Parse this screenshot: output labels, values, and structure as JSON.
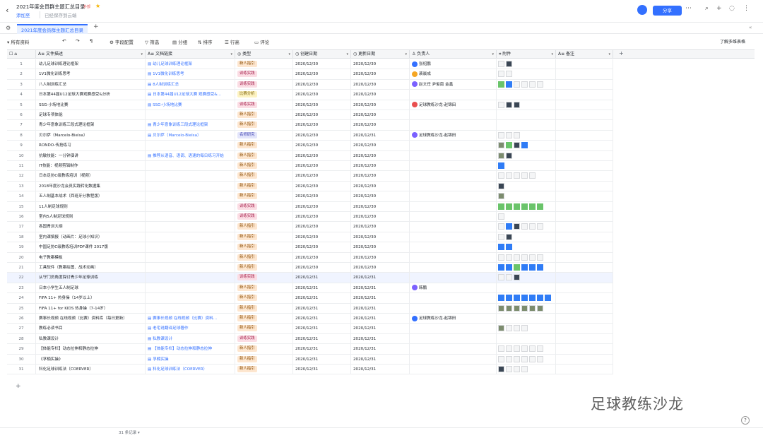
{
  "header": {
    "title": "2021年度会员群主题汇总目录",
    "badge": "外部",
    "add_to": "添加至",
    "saved": "已经保存到云端",
    "share": "分享"
  },
  "tab": {
    "name": "2021年度会员群主题汇总目录"
  },
  "toolbar": {
    "all_data": "所有资料",
    "field_config": "字段配置",
    "filter": "筛选",
    "group": "分组",
    "sort": "排序",
    "row_height": "行高",
    "comment": "评论",
    "learn": "了解多维表格"
  },
  "columns": {
    "name": "文件描述",
    "link": "文档链接",
    "type": "类型",
    "created": "创建日期",
    "updated": "更新日期",
    "owner": "负责人",
    "attachment": "附件",
    "note": "备注"
  },
  "rows": [
    {
      "no": "1",
      "name": "幼儿足球训练理论框架",
      "link": "幼儿足球训练理论框架",
      "type": "新人指引",
      "tc": "new",
      "created": "2020/12/30",
      "updated": "2020/12/30",
      "owner": "张绍鹏",
      "att": "pd"
    },
    {
      "no": "2",
      "name": "1V1微化训练思考",
      "link": "1V1微化训练思考",
      "type": "训练实践",
      "tc": "train",
      "created": "2020/12/30",
      "updated": "2020/12/30",
      "owner": "裴晨成",
      "att": "pp"
    },
    {
      "no": "3",
      "name": "八人制训练汇总",
      "link": "8人制训练汇总",
      "type": "训练实践",
      "tc": "train",
      "created": "2020/12/30",
      "updated": "2020/12/30",
      "owner": "赵文任  尹俊南  金鑫",
      "att": "gbpppp"
    },
    {
      "no": "4",
      "name": "日本第44届U12足球大赛观赛感受&分析",
      "link": "日本第44届U12足球大赛 观赛感受&...",
      "type": "比赛分析",
      "tc": "biz",
      "created": "2020/12/30",
      "updated": "2020/12/30",
      "owner": "",
      "att": ""
    },
    {
      "no": "5",
      "name": "SSG-小场地比赛",
      "link": "SSG-小场地比赛",
      "type": "训练实践",
      "tc": "train",
      "created": "2020/12/30",
      "updated": "2020/12/30",
      "owner": "足球教练沙龙-赵锦田",
      "att": "pdd"
    },
    {
      "no": "6",
      "name": "足球专项体能",
      "link": "",
      "type": "新人指引",
      "tc": "new",
      "created": "2020/12/30",
      "updated": "2020/12/30",
      "owner": "",
      "att": ""
    },
    {
      "no": "7",
      "name": "青少年意象训练三段式理论框架",
      "link": "青少年意象训练三段式理论框架",
      "type": "新人指引",
      "tc": "new",
      "created": "2020/12/30",
      "updated": "2020/12/30",
      "owner": "",
      "att": ""
    },
    {
      "no": "8",
      "name": "贝尔萨（Marcelo-Bielsa）",
      "link": "贝尔萨（Marcelo-Bielsa）",
      "type": "名师研究",
      "tc": "pro",
      "created": "2020/12/30",
      "updated": "2020/12/31",
      "owner": "足球教练沙龙-赵锦田",
      "att": "ppp"
    },
    {
      "no": "9",
      "name": "RONDO-传抢练习",
      "link": "",
      "type": "新人指引",
      "tc": "new",
      "created": "2020/12/30",
      "updated": "2020/12/30",
      "owner": "",
      "att": "ngdb"
    },
    {
      "no": "10",
      "name": "抗敏技能：一分钟演讲",
      "link": "推荐从语音、语调、语速的每日练习开始",
      "type": "新人指引",
      "tc": "new",
      "created": "2020/12/30",
      "updated": "2020/12/30",
      "owner": "",
      "att": "nd"
    },
    {
      "no": "11",
      "name": "IT技能：视频剪辑制作",
      "link": "",
      "type": "新人指引",
      "tc": "new",
      "created": "2020/12/30",
      "updated": "2020/12/30",
      "owner": "",
      "att": "b"
    },
    {
      "no": "12",
      "name": "日本足协C级教练培训（视频）",
      "link": "",
      "type": "新人指引",
      "tc": "new",
      "created": "2020/12/30",
      "updated": "2020/12/30",
      "owner": "",
      "att": "ppppp"
    },
    {
      "no": "13",
      "name": "2018年度沙龙会员实践转化数据集",
      "link": "",
      "type": "新人指引",
      "tc": "new",
      "created": "2020/12/30",
      "updated": "2020/12/30",
      "owner": "",
      "att": "d"
    },
    {
      "no": "14",
      "name": "五人制基本战术（西班牙分教程版）",
      "link": "",
      "type": "新人指引",
      "tc": "new",
      "created": "2020/12/30",
      "updated": "2020/12/30",
      "owner": "",
      "att": "n"
    },
    {
      "no": "15",
      "name": "11人制足球规则",
      "link": "",
      "type": "训练实践",
      "tc": "train",
      "created": "2020/12/30",
      "updated": "2020/12/30",
      "owner": "",
      "att": "gggggg"
    },
    {
      "no": "16",
      "name": "室内5人制足球规则",
      "link": "",
      "type": "训练实践",
      "tc": "train",
      "created": "2020/12/30",
      "updated": "2020/12/30",
      "owner": "",
      "att": "p"
    },
    {
      "no": "17",
      "name": "各国青训大纲",
      "link": "",
      "type": "新人指引",
      "tc": "new",
      "created": "2020/12/30",
      "updated": "2020/12/30",
      "owner": "",
      "att": "pbdppp"
    },
    {
      "no": "18",
      "name": "室内课慎报（动画片：足球小知识）",
      "link": "",
      "type": "新人指引",
      "tc": "new",
      "created": "2020/12/30",
      "updated": "2020/12/30",
      "owner": "",
      "att": "pd"
    },
    {
      "no": "19",
      "name": "中国足协C级教练培训PDF课件 2017版",
      "link": "",
      "type": "新人指引",
      "tc": "new",
      "created": "2020/12/30",
      "updated": "2020/12/30",
      "owner": "",
      "att": "bb"
    },
    {
      "no": "20",
      "name": "电子教案模板",
      "link": "",
      "type": "新人指引",
      "tc": "new",
      "created": "2020/12/30",
      "updated": "2020/12/30",
      "owner": "",
      "att": "pppppp"
    },
    {
      "no": "21",
      "name": "工具软件（教案绘图、战术动画）",
      "link": "",
      "type": "新人指引",
      "tc": "new",
      "created": "2020/12/30",
      "updated": "2020/12/30",
      "owner": "",
      "att": "bbgbbb"
    },
    {
      "no": "22",
      "name": "从守门员角度探讨青少年足球训练",
      "link": "",
      "type": "训练实践",
      "tc": "train",
      "created": "2020/12/31",
      "updated": "2020/12/31",
      "owner": "",
      "att": "ppd",
      "sel": true
    },
    {
      "no": "23",
      "name": "日本小学生五人制足球",
      "link": "",
      "type": "新人指引",
      "tc": "new",
      "created": "2020/12/31",
      "updated": "2020/12/31",
      "owner": "韩鹏",
      "att": ""
    },
    {
      "no": "24",
      "name": "FIFA 11+ 热身操（14岁以上）",
      "link": "",
      "type": "新人指引",
      "tc": "new",
      "created": "2020/12/31",
      "updated": "2020/12/31",
      "owner": "",
      "att": "bbbbbbb"
    },
    {
      "no": "25",
      "name": "FIFA 11+ for KIDS 热身操（7-14岁）",
      "link": "",
      "type": "新人指引",
      "tc": "new",
      "created": "2020/12/31",
      "updated": "2020/12/31",
      "owner": "",
      "att": "nnnnnn"
    },
    {
      "no": "26",
      "name": "赛事长视频 在线视频（比赛）资料库（每日更新）",
      "link": "赛事长视频 在线视频（比赛）资料...",
      "type": "新人指引",
      "tc": "new",
      "created": "2020/12/31",
      "updated": "2020/12/31",
      "owner": "足球教练沙龙-赵锦田",
      "att": ""
    },
    {
      "no": "27",
      "name": "教练必读书目",
      "link": "老宅说翻译足球著作",
      "type": "新人指引",
      "tc": "new",
      "created": "2020/12/31",
      "updated": "2020/12/31",
      "owner": "",
      "att": "nppp"
    },
    {
      "no": "28",
      "name": "私教课设计",
      "link": "私教课设计",
      "type": "训练实践",
      "tc": "train",
      "created": "2020/12/31",
      "updated": "2020/12/31",
      "owner": "",
      "att": ""
    },
    {
      "no": "29",
      "name": "【体能专栏】动态拉伸和静态拉伸",
      "link": "【体能专栏】动态拉伸和静态拉伸",
      "type": "新人指引",
      "tc": "new",
      "created": "2020/12/31",
      "updated": "2020/12/31",
      "owner": "",
      "att": "pppppp"
    },
    {
      "no": "30",
      "name": "《孚楠实操》",
      "link": "孚楠实操",
      "type": "新人指引",
      "tc": "new",
      "created": "2020/12/31",
      "updated": "2020/12/31",
      "owner": "",
      "att": "pppppp"
    },
    {
      "no": "31",
      "name": "科化足球训练法（COERVER）",
      "link": "科化足球训练法（COERVER）",
      "type": "新人指引",
      "tc": "new",
      "created": "2020/12/31",
      "updated": "2020/12/31",
      "owner": "",
      "att": "dppp"
    }
  ],
  "footer": {
    "count": "31 条记录"
  },
  "watermark": "足球教练沙龙",
  "colors": {
    "accent": "#3370ff"
  }
}
